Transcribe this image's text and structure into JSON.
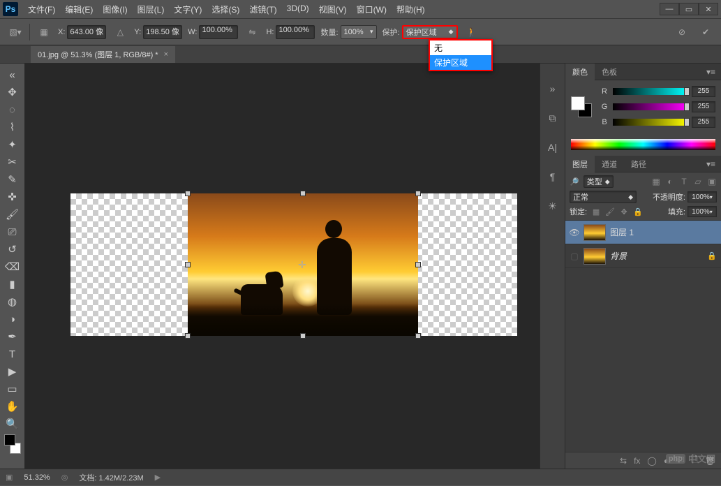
{
  "app": {
    "logo": "Ps"
  },
  "menu": [
    "文件(F)",
    "编辑(E)",
    "图像(I)",
    "图层(L)",
    "文字(Y)",
    "选择(S)",
    "滤镜(T)",
    "3D(D)",
    "视图(V)",
    "窗口(W)",
    "帮助(H)"
  ],
  "options": {
    "x_label": "X:",
    "x_value": "643.00 像",
    "y_label": "Y:",
    "y_value": "198.50 像",
    "w_label": "W:",
    "w_value": "100.00%",
    "h_label": "H:",
    "h_value": "100.00%",
    "qty_label": "数量:",
    "qty_value": "100%",
    "protect_label": "保护:",
    "protect_value": "保护区域"
  },
  "dropdown": {
    "items": [
      "无",
      "保护区域"
    ],
    "selected": 1
  },
  "filetab": {
    "title": "01.jpg @ 51.3% (图层 1, RGB/8#) *",
    "close": "×"
  },
  "panels": {
    "color_tabs": [
      "颜色",
      "色板"
    ],
    "rgb": {
      "r_label": "R",
      "g_label": "G",
      "b_label": "B",
      "r": "255",
      "g": "255",
      "b": "255"
    },
    "layer_tabs": [
      "图层",
      "通道",
      "路径"
    ],
    "kind_label": "类型",
    "blend_value": "正常",
    "opacity_label": "不透明度:",
    "opacity_value": "100%",
    "lock_label": "锁定:",
    "fill_label": "填充:",
    "fill_value": "100%",
    "layers": [
      {
        "name": "图层 1",
        "visible": true,
        "selected": true
      },
      {
        "name": "背景",
        "visible": false,
        "selected": false,
        "locked": true
      }
    ]
  },
  "status": {
    "zoom": "51.32%",
    "doc_label": "文档:",
    "doc_value": "1.42M/2.23M"
  },
  "watermark": {
    "badge": "php",
    "text": "中文网"
  }
}
